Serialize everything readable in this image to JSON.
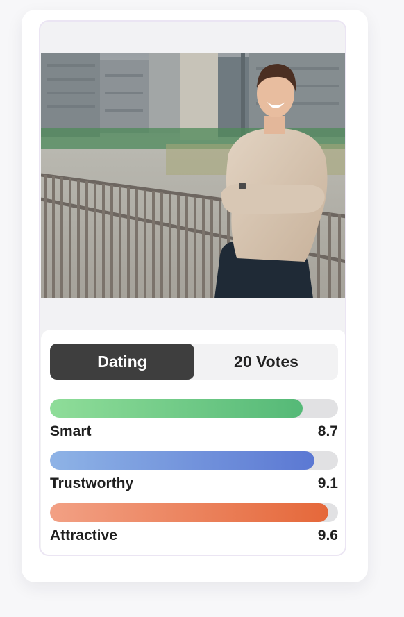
{
  "card": {
    "photo_alt": "Profile photo",
    "tabs": {
      "active_label": "Dating",
      "votes_label": "20 Votes"
    },
    "metrics": [
      {
        "label": "Smart",
        "value": "8.7",
        "score": 8.7,
        "fill_fraction": 0.877,
        "color_start": "#8fdd99",
        "color_end": "#55b977"
      },
      {
        "label": "Trustworthy",
        "value": "9.1",
        "score": 9.1,
        "fill_fraction": 0.917,
        "color_start": "#8eb3e6",
        "color_end": "#5b78d3"
      },
      {
        "label": "Attractive",
        "value": "9.6",
        "score": 9.6,
        "fill_fraction": 0.966,
        "color_start": "#f2a084",
        "color_end": "#e5683a"
      }
    ]
  }
}
